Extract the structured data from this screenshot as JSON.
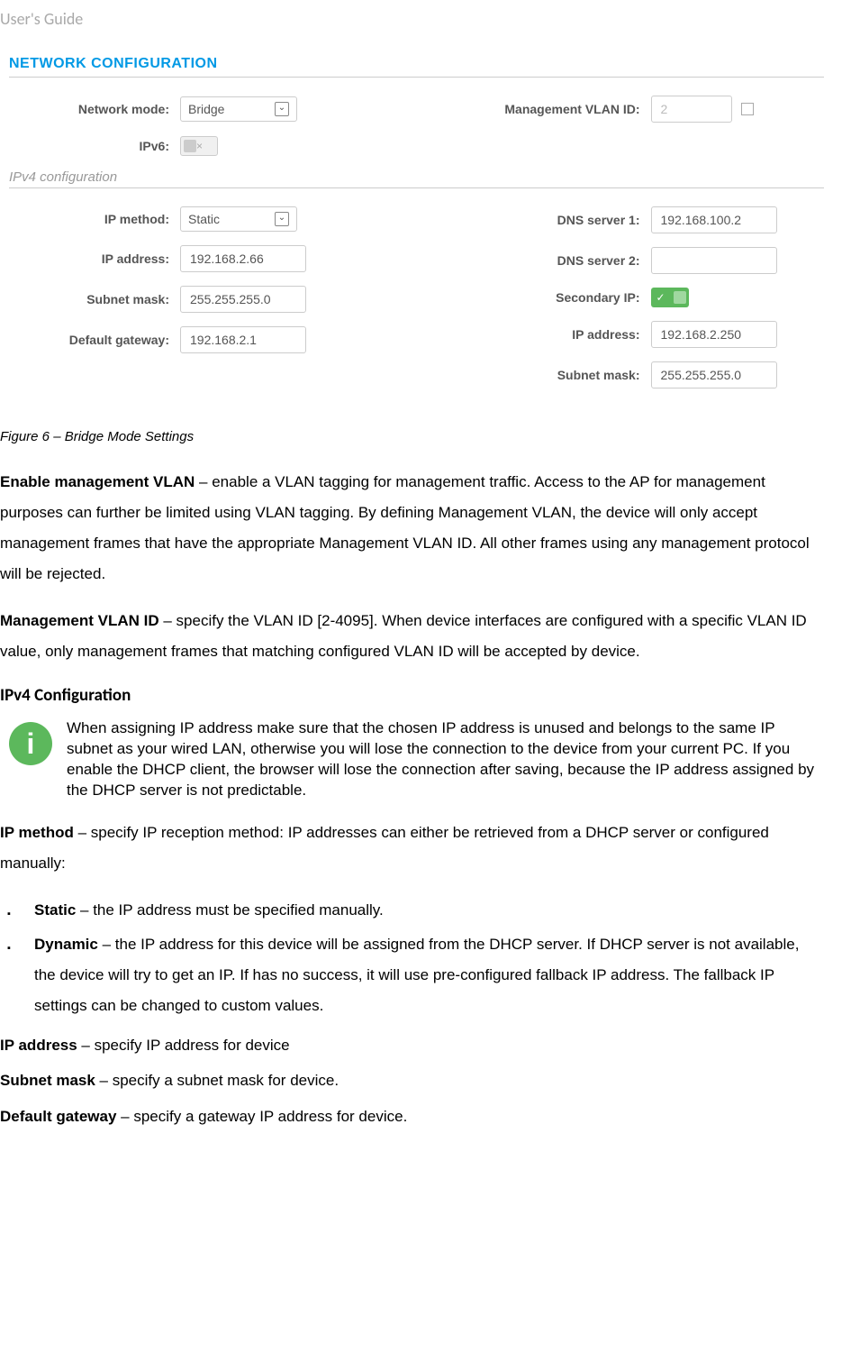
{
  "header": "User's Guide",
  "screenshot": {
    "section_title": "NETWORK CONFIGURATION",
    "row1": {
      "network_mode_label": "Network mode:",
      "network_mode_value": "Bridge",
      "vlan_label": "Management VLAN ID:",
      "vlan_value": "2"
    },
    "row2": {
      "ipv6_label": "IPv6:",
      "ipv6_x": "×"
    },
    "subsection": "IPv4 configuration",
    "ipv4": {
      "ip_method_label": "IP method:",
      "ip_method_value": "Static",
      "ip_address_label": "IP address:",
      "ip_address_value": "192.168.2.66",
      "subnet_label": "Subnet mask:",
      "subnet_value": "255.255.255.0",
      "gateway_label": "Default gateway:",
      "gateway_value": "192.168.2.1",
      "dns1_label": "DNS server 1:",
      "dns1_value": "192.168.100.2",
      "dns2_label": "DNS server 2:",
      "dns2_value": "",
      "secondary_label": "Secondary IP:",
      "ip2_label": "IP address:",
      "ip2_value": "192.168.2.250",
      "subnet2_label": "Subnet mask:",
      "subnet2_value": "255.255.255.0"
    }
  },
  "caption": "Figure 6 – Bridge Mode Settings",
  "para1": {
    "bold": "Enable management VLAN",
    "text": " – enable a VLAN tagging for management traffic. Access to the AP for management purposes can further be limited using VLAN tagging. By defining Management VLAN, the device will only accept management frames that have the appropriate Management VLAN ID. All other frames using any management protocol will be rejected."
  },
  "para2": {
    "bold": "Management VLAN ID",
    "text": " – specify the VLAN ID [2-4095]. When device interfaces are configured with a specific VLAN ID value, only management frames that matching configured VLAN ID will be accepted by device."
  },
  "subsection_heading": "IPv4 Configuration",
  "info_text": "When assigning IP address make sure that the chosen IP address is unused and belongs to the same IP subnet as your wired LAN, otherwise you will lose the connection to the device from your current PC. If you enable the DHCP client, the browser will lose the connection after saving, because the IP address assigned by the DHCP server is not predictable.",
  "para3": {
    "bold": "IP method",
    "text": " – specify IP reception method: IP addresses can either be retrieved from a DHCP server or configured manually:"
  },
  "bullet1": {
    "bold": "Static",
    "text": " – the IP address must be specified manually."
  },
  "bullet2": {
    "bold": "Dynamic",
    "text": " – the IP address for this device will be assigned from the DHCP server. If DHCP server is not available, the device will try to get an IP. If has no success, it will use pre-configured fallback IP address. The fallback IP settings can be changed to custom values."
  },
  "para4": {
    "bold": "IP address",
    "text": " – specify IP address for device"
  },
  "para5": {
    "bold": "Subnet mask",
    "text": " – specify a subnet mask for device."
  },
  "para6": {
    "bold": "Default gateway",
    "text": " – specify a gateway IP address for device."
  }
}
